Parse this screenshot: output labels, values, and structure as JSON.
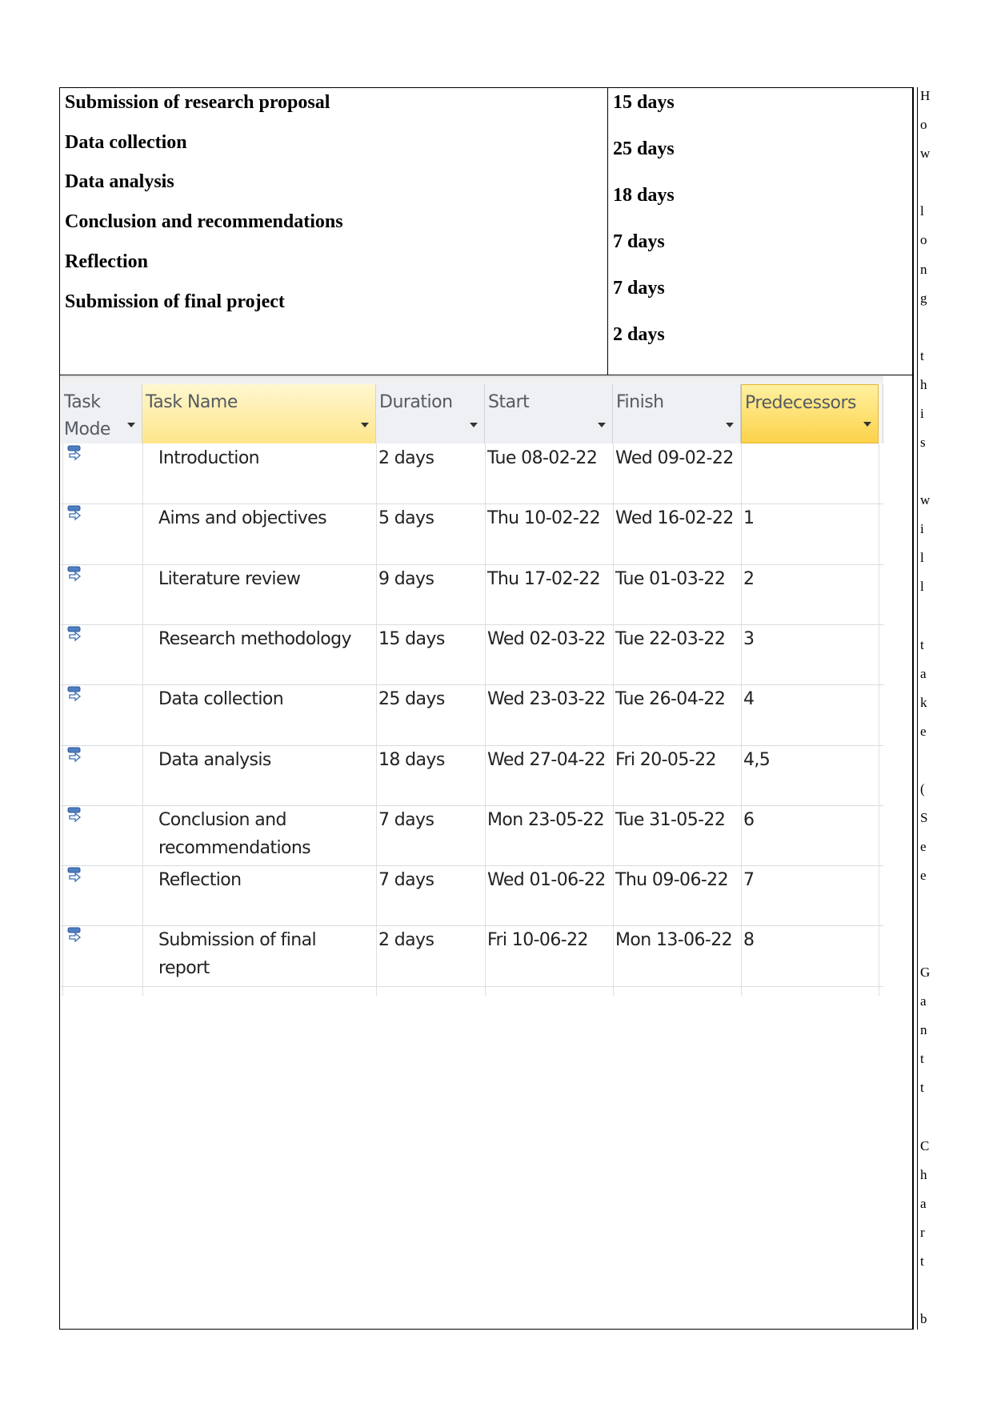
{
  "summary": {
    "tasks": [
      "Submission of research proposal",
      "Data collection",
      "Data analysis",
      "Conclusion and recommendations",
      "Reflection",
      "Submission of final project"
    ],
    "durations": [
      "15 days",
      "25 days",
      "18 days",
      "7 days",
      "7 days",
      "2 days"
    ]
  },
  "side_text": [
    "H",
    "o",
    "w",
    "l",
    "o",
    "n",
    "g",
    "t",
    "h",
    "i",
    "s",
    "w",
    "i",
    "l",
    "l",
    "t",
    "a",
    "k",
    "e",
    "(",
    "S",
    "e",
    "e",
    "G",
    "a",
    "n",
    "t",
    "t",
    "C",
    "h",
    "a",
    "r",
    "t",
    "b"
  ],
  "grid": {
    "headers": {
      "task_mode": "Task Mode",
      "task_name": "Task Name",
      "duration": "Duration",
      "start": "Start",
      "finish": "Finish",
      "predecessors": "Predecessors"
    },
    "rows": [
      {
        "name": "Introduction",
        "duration": "2 days",
        "start": "Tue 08-02-22",
        "finish": "Wed 09-02-22",
        "pred": ""
      },
      {
        "name": "Aims and objectives",
        "duration": "5 days",
        "start": "Thu 10-02-22",
        "finish": "Wed 16-02-22",
        "pred": "1"
      },
      {
        "name": "Literature review",
        "duration": "9 days",
        "start": "Thu 17-02-22",
        "finish": "Tue 01-03-22",
        "pred": "2"
      },
      {
        "name": "Research methodology",
        "duration": "15 days",
        "start": "Wed 02-03-22",
        "finish": "Tue 22-03-22",
        "pred": "3"
      },
      {
        "name": "Data collection",
        "duration": "25 days",
        "start": "Wed 23-03-22",
        "finish": "Tue 26-04-22",
        "pred": "4"
      },
      {
        "name": "Data analysis",
        "duration": "18 days",
        "start": "Wed 27-04-22",
        "finish": "Fri 20-05-22",
        "pred": "4,5"
      },
      {
        "name": "Conclusion and recommendations",
        "duration": "7 days",
        "start": "Mon 23-05-22",
        "finish": "Tue 31-05-22",
        "pred": "6"
      },
      {
        "name": "Reflection",
        "duration": "7 days",
        "start": "Wed 01-06-22",
        "finish": "Thu 09-06-22",
        "pred": "7"
      },
      {
        "name": "Submission of final report",
        "duration": "2 days",
        "start": "Fri 10-06-22",
        "finish": "Mon 13-06-22",
        "pred": "8"
      }
    ],
    "task_mode_icon": "auto-scheduled-task-icon"
  }
}
